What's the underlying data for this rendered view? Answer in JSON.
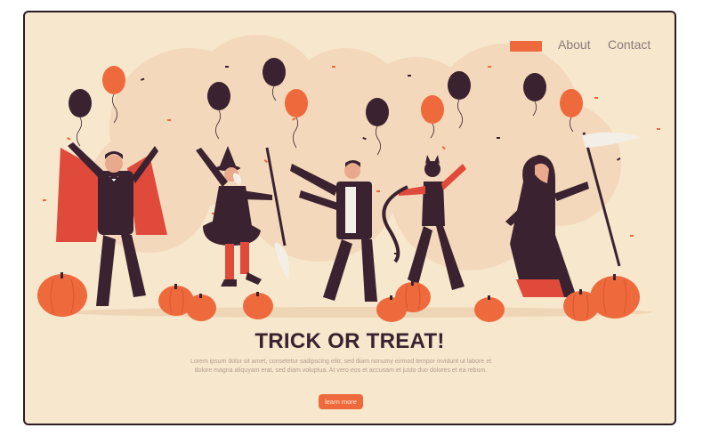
{
  "nav": {
    "about": "About",
    "contact": "Contact"
  },
  "hero": {
    "title": "TRICK OR TREAT!",
    "description": "Lorem ipsum dolor sit amet, consetetur sadipscing elitr, sed diam nonumy eirmod tempor invidunt ut labore et dolore magna aliquyam erat, sed diam voluptua. At vero eos et accusam et justo duo dolores et ea rebum.",
    "cta_label": "learn more"
  },
  "colors": {
    "background": "#f7e7cc",
    "accent": "#ee6a3c",
    "dark": "#3a2230",
    "cape": "#e04a3a"
  }
}
